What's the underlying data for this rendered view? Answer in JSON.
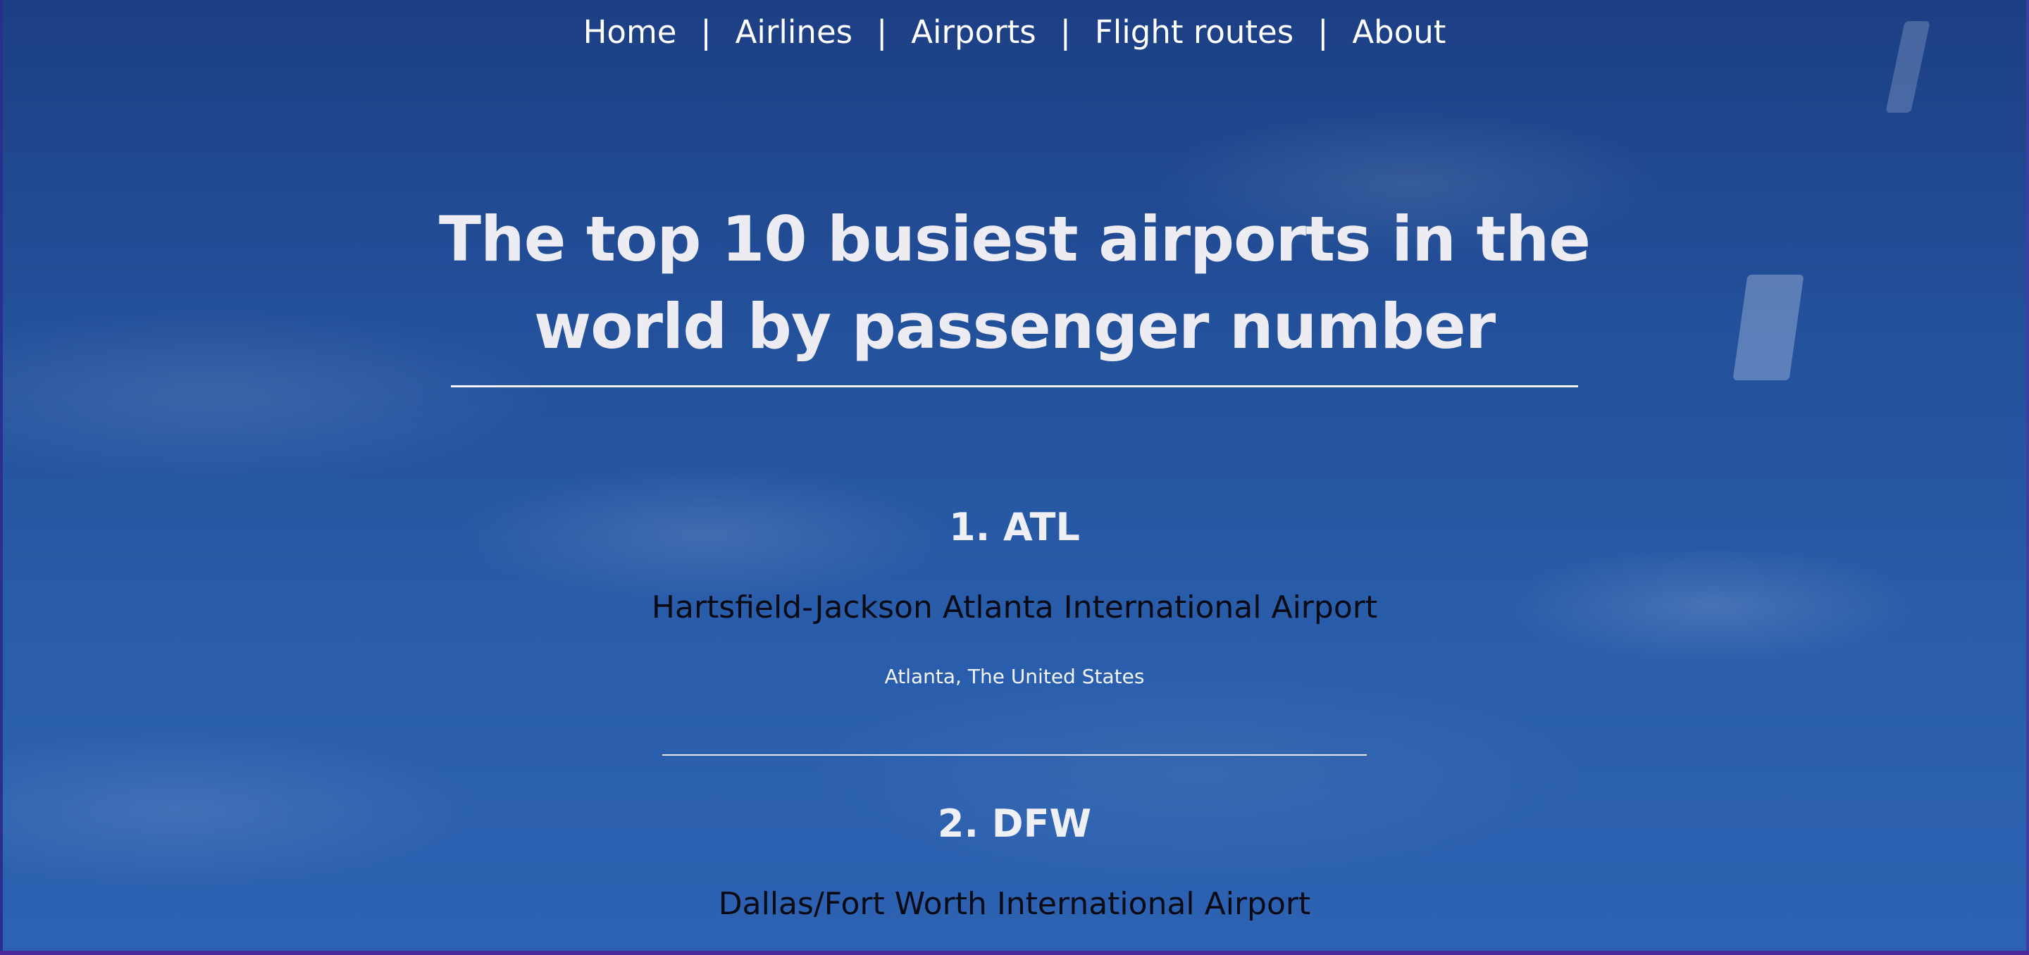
{
  "nav": {
    "items": [
      {
        "label": "Home"
      },
      {
        "label": "Airlines"
      },
      {
        "label": "Airports"
      },
      {
        "label": "Flight routes"
      },
      {
        "label": "About"
      }
    ],
    "separator": "|"
  },
  "page": {
    "title_line1": "The top 10 busiest airports in the",
    "title_line2": "world by passenger number"
  },
  "airports": [
    {
      "rank_code": "1. ATL",
      "name": "Hartsfield-Jackson Atlanta International Airport",
      "location": "Atlanta, The United States"
    },
    {
      "rank_code": "2. DFW",
      "name": "Dallas/Fort Worth International Airport"
    }
  ],
  "colors": {
    "sky": "#2a5aa6",
    "heading_text": "#ececf2",
    "airport_name_text": "#0a0a14",
    "rule": "#f0f2f8"
  }
}
